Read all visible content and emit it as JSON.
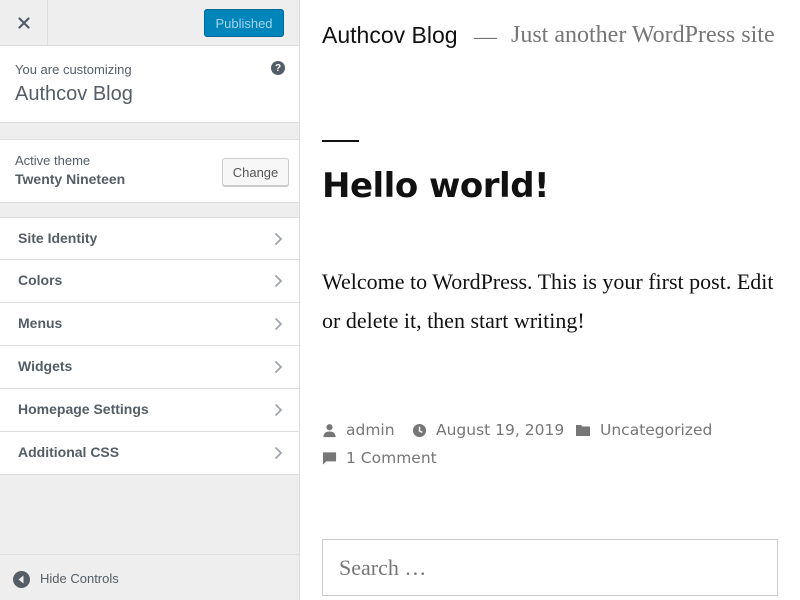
{
  "sidebar": {
    "header": {
      "close_icon": "close-icon",
      "publish_label": "Published",
      "publish_color": "#0085ba"
    },
    "customizing": {
      "label": "You are customizing",
      "title": "Authcov Blog",
      "help_icon": "?"
    },
    "theme": {
      "label": "Active theme",
      "name": "Twenty Nineteen",
      "change_label": "Change"
    },
    "sections": [
      {
        "label": "Site Identity"
      },
      {
        "label": "Colors"
      },
      {
        "label": "Menus"
      },
      {
        "label": "Widgets"
      },
      {
        "label": "Homepage Settings"
      },
      {
        "label": "Additional CSS"
      }
    ],
    "footer": {
      "hide_label": "Hide Controls",
      "hide_icon": "arrow-left-circle-icon"
    }
  },
  "preview": {
    "site_title": "Authcov Blog",
    "separator": "—",
    "site_description": "Just another WordPress site",
    "post": {
      "title": "Hello world!",
      "body": "Welcome to WordPress. This is your first post. Edit or delete it, then start writing!",
      "author": "admin",
      "date": "August 19, 2019",
      "category": "Uncategorized",
      "comments": "1 Comment"
    },
    "search": {
      "placeholder": "Search …"
    }
  }
}
